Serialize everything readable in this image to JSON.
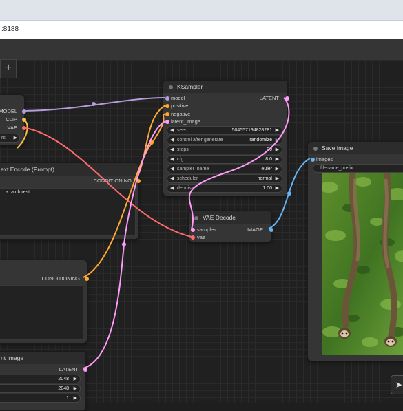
{
  "browser": {
    "url_fragment": ":8188"
  },
  "toolbar": {
    "add_label": "+"
  },
  "colors": {
    "model": "#b39ddb",
    "clip": "#f5c242",
    "vae": "#ff6b6b",
    "conditioning": "#ffa931",
    "latent": "#ff9cf9",
    "image": "#64b5f6",
    "canvas": "#202020"
  },
  "nodes": {
    "checkpoint": {
      "outputs": [
        "MODEL",
        "CLIP",
        "VAE"
      ],
      "widget_fragment": "rs"
    },
    "clip_positive": {
      "title": "ext Encode (Prompt)",
      "output": "CONDITIONING",
      "text": "a rainforest"
    },
    "clip_negative": {
      "output": "CONDITIONING"
    },
    "empty_latent": {
      "title": "nt Image",
      "output": "LATENT",
      "width": "2048",
      "height": "2048",
      "batch": "1"
    },
    "ksampler": {
      "title": "KSampler",
      "inputs": [
        "model",
        "positive",
        "negative",
        "latent_image"
      ],
      "output": "LATENT",
      "widgets": [
        {
          "label": "seed",
          "value": "504557194828281"
        },
        {
          "label": "control after generate",
          "value": "randomize"
        },
        {
          "label": "steps",
          "value": "20"
        },
        {
          "label": "cfg",
          "value": "8.0"
        },
        {
          "label": "sampler_name",
          "value": "euler"
        },
        {
          "label": "scheduler",
          "value": "normal"
        },
        {
          "label": "denoise",
          "value": "1.00"
        }
      ]
    },
    "vae_decode": {
      "title": "VAE Decode",
      "inputs": [
        "samples",
        "vae"
      ],
      "output": "IMAGE"
    },
    "save_image": {
      "title": "Save Image",
      "input": "images",
      "filename_prefix": "filename_prefix"
    }
  }
}
